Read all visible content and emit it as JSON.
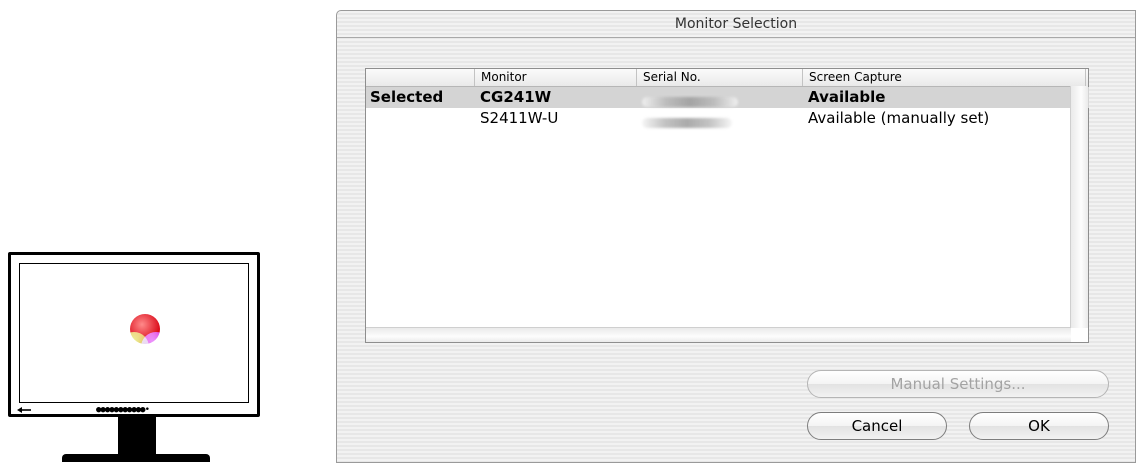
{
  "dialog": {
    "title": "Monitor Selection",
    "columns": [
      "",
      "Monitor",
      "Serial No.",
      "Screen Capture"
    ],
    "rows": [
      {
        "selected": "Selected",
        "monitor": "CG241W",
        "serial": "",
        "capture": "Available"
      },
      {
        "selected": "",
        "monitor": "S2411W-U",
        "serial": "",
        "capture": "Available (manually set)"
      }
    ],
    "buttons": {
      "manual_settings": "Manual Settings...",
      "cancel": "Cancel",
      "ok": "OK"
    }
  },
  "illustration": {
    "button_dots": "●●●●●●●●●●●•",
    "logo_colors": [
      "#e8131b",
      "#1ab535",
      "#1b2fe0",
      "#ff00ff",
      "#ffff00",
      "#00ffff",
      "#ffffff"
    ]
  }
}
